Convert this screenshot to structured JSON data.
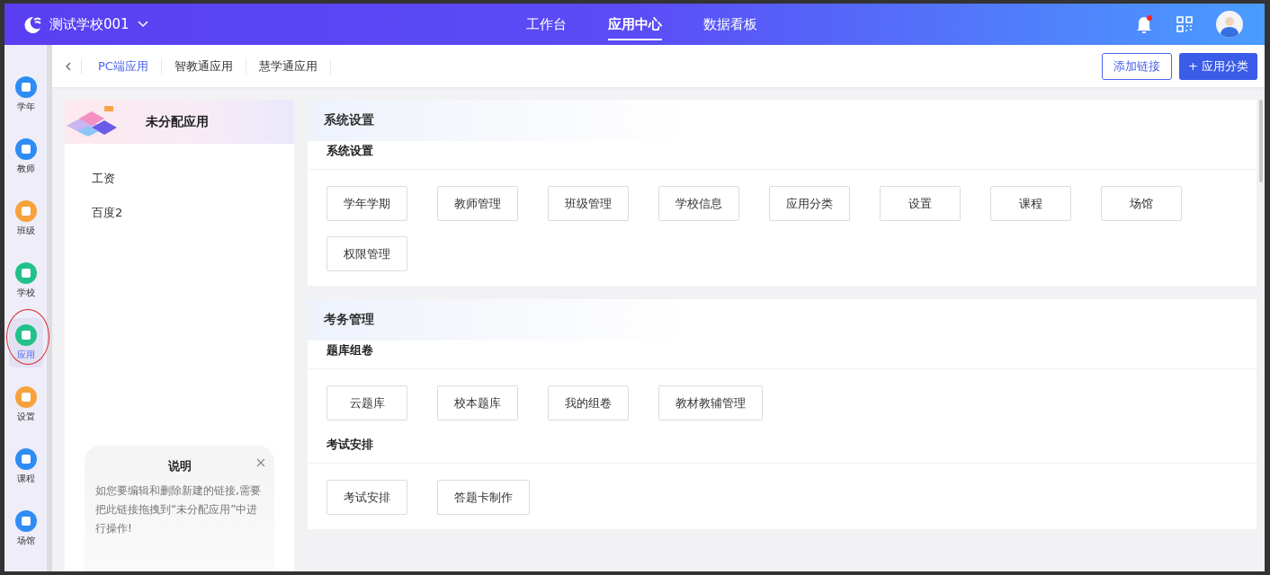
{
  "header": {
    "school": "测试学校001",
    "nav": [
      {
        "label": "工作台",
        "selected": false
      },
      {
        "label": "应用中心",
        "selected": true
      },
      {
        "label": "数据看板",
        "selected": false
      }
    ],
    "has_notification": true
  },
  "sidebar": {
    "items": [
      {
        "label": "学年",
        "selected": false,
        "color": "#2f8cf5"
      },
      {
        "label": "教师",
        "selected": false,
        "color": "#2f8cf5"
      },
      {
        "label": "班级",
        "selected": false,
        "color": "#f7a23a"
      },
      {
        "label": "学校",
        "selected": false,
        "color": "#22c08a"
      },
      {
        "label": "应用",
        "selected": true,
        "color": "#22c08a"
      },
      {
        "label": "设置",
        "selected": false,
        "color": "#f7a23a"
      },
      {
        "label": "课程",
        "selected": false,
        "color": "#2f8cf5"
      },
      {
        "label": "场馆",
        "selected": false,
        "color": "#2f8cf5"
      }
    ]
  },
  "tabs": [
    {
      "label": "PC端应用",
      "selected": true
    },
    {
      "label": "智教通应用",
      "selected": false
    },
    {
      "label": "慧学通应用",
      "selected": false
    }
  ],
  "actions": {
    "add_link": "添加链接",
    "add_category": "+ 应用分类"
  },
  "unassigned": {
    "title": "未分配应用",
    "items": [
      "工资",
      "百度2"
    ],
    "note": {
      "title": "说明",
      "text": "如您要编辑和删除新建的链接,需要把此链接拖拽到“未分配应用”中进行操作!"
    }
  },
  "sections": [
    {
      "title": "系统设置",
      "groups": [
        {
          "title": "系统设置",
          "apps": [
            "学年学期",
            "教师管理",
            "班级管理",
            "学校信息",
            "应用分类",
            "设置",
            "课程",
            "场馆",
            "权限管理"
          ]
        }
      ]
    },
    {
      "title": "考务管理",
      "groups": [
        {
          "title": "题库组卷",
          "apps": [
            "云题库",
            "校本题库",
            "我的组卷",
            "教材教辅管理"
          ]
        },
        {
          "title": "考试安排",
          "apps": [
            "考试安排",
            "答题卡制作"
          ]
        }
      ]
    }
  ]
}
